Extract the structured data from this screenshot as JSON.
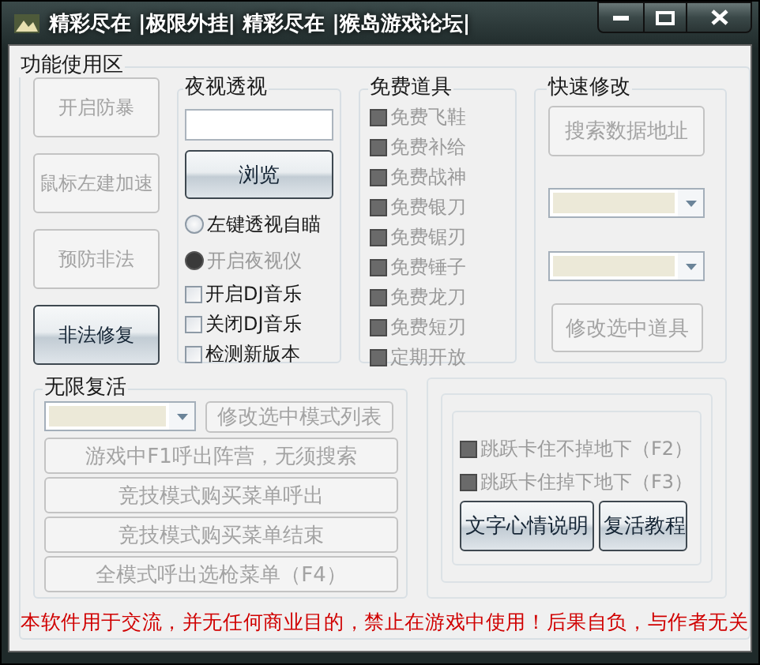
{
  "window": {
    "title": "精彩尽在 |极限外挂| 精彩尽在 |猴岛游戏论坛|"
  },
  "main_group": {
    "title": "功能使用区"
  },
  "left_buttons": [
    {
      "label": "开启防暴",
      "disabled": true
    },
    {
      "label": "鼠标左建加速",
      "disabled": true
    },
    {
      "label": "预防非法",
      "disabled": true
    },
    {
      "label": "非法修复",
      "disabled": false
    }
  ],
  "night_vision": {
    "title": "夜视透视",
    "browse_button": {
      "label": "浏览",
      "disabled": false
    },
    "options": [
      {
        "kind": "radio",
        "label": "左键透视自瞄",
        "selected": false,
        "disabled": false
      },
      {
        "kind": "radio",
        "label": "开启夜视仪",
        "selected": true,
        "disabled": true
      },
      {
        "kind": "checkbox",
        "label": "开启DJ音乐",
        "checked": false,
        "disabled": false
      },
      {
        "kind": "checkbox",
        "label": "关闭DJ音乐",
        "checked": false,
        "disabled": false
      },
      {
        "kind": "checkbox",
        "label": "检测新版本",
        "checked": false,
        "disabled": false
      }
    ]
  },
  "free_items": {
    "title": "免费道具",
    "items": [
      {
        "label": "免费飞鞋",
        "checked": false,
        "disabled": true
      },
      {
        "label": "免费补给",
        "checked": false,
        "disabled": true
      },
      {
        "label": "免费战神",
        "checked": false,
        "disabled": true
      },
      {
        "label": "免费银刀",
        "checked": false,
        "disabled": true
      },
      {
        "label": "免费锯刃",
        "checked": false,
        "disabled": true
      },
      {
        "label": "免费锤子",
        "checked": false,
        "disabled": true
      },
      {
        "label": "免费龙刀",
        "checked": false,
        "disabled": true
      },
      {
        "label": "免费短刃",
        "checked": false,
        "disabled": true
      },
      {
        "label": "定期开放",
        "checked": false,
        "disabled": true
      }
    ]
  },
  "quick_edit": {
    "title": "快速修改",
    "search_button": {
      "label": "搜索数据地址",
      "disabled": true
    },
    "dropdowns": [
      {
        "disabled": true
      },
      {
        "disabled": true
      }
    ],
    "edit_button": {
      "label": "修改选中道具",
      "disabled": true
    }
  },
  "revive": {
    "title": "无限复活",
    "dropdown": {
      "disabled": true
    },
    "edit_button": {
      "label": "修改选中模式列表",
      "disabled": true
    },
    "buttons": [
      {
        "label": "游戏中F1呼出阵营，无须搜索",
        "disabled": true
      },
      {
        "label": "竞技模式购买菜单呼出",
        "disabled": true
      },
      {
        "label": "竞技模式购买菜单结束",
        "disabled": true
      },
      {
        "label": "全模式呼出选枪菜单（F4）",
        "disabled": true
      }
    ]
  },
  "jump": {
    "options": [
      {
        "label": "跳跃卡住不掉地下（F2）",
        "checked": false,
        "disabled": true
      },
      {
        "label": "跳跃卡住掉下地下（F3）",
        "checked": false,
        "disabled": true
      }
    ],
    "buttons": [
      {
        "label": "文字心情说明",
        "disabled": false
      },
      {
        "label": "复活教程",
        "disabled": false
      }
    ]
  },
  "footer": {
    "notice": "本软件用于交流，并无任何商业目的，禁止在游戏中使用！后果自负，与作者无关"
  }
}
